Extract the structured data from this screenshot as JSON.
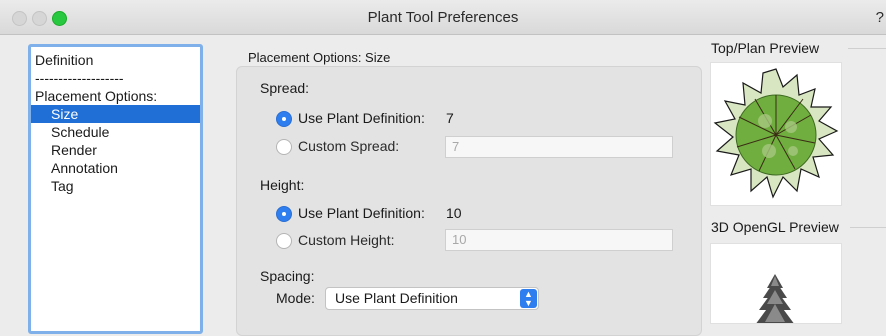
{
  "window": {
    "title": "Plant Tool Preferences",
    "help": "?"
  },
  "nav": {
    "items": [
      {
        "label": "Definition",
        "indent": false,
        "selected": false
      },
      {
        "label": "-------------------",
        "indent": false,
        "selected": false
      },
      {
        "label": "Placement Options:",
        "indent": false,
        "selected": false
      },
      {
        "label": "Size",
        "indent": true,
        "selected": true
      },
      {
        "label": "Schedule",
        "indent": true,
        "selected": false
      },
      {
        "label": "Render",
        "indent": true,
        "selected": false
      },
      {
        "label": "Annotation",
        "indent": true,
        "selected": false
      },
      {
        "label": "Tag",
        "indent": true,
        "selected": false
      }
    ]
  },
  "panel": {
    "section_title": "Placement Options: Size",
    "spread": {
      "heading": "Spread:",
      "use_definition_label": "Use Plant Definition:",
      "use_definition_value": "7",
      "custom_label": "Custom Spread:",
      "custom_value": "7",
      "selected": "use_definition"
    },
    "height": {
      "heading": "Height:",
      "use_definition_label": "Use Plant Definition:",
      "use_definition_value": "10",
      "custom_label": "Custom Height:",
      "custom_value": "10",
      "selected": "use_definition"
    },
    "spacing": {
      "heading": "Spacing:",
      "mode_label": "Mode:",
      "mode_value": "Use Plant Definition"
    }
  },
  "previews": {
    "top_plan_title": "Top/Plan Preview",
    "opengl_title": "3D OpenGL Preview"
  },
  "colors": {
    "accent": "#1f6fd6",
    "focus_ring": "#7fb0ea",
    "plant_green": "#6fae3f",
    "plant_light": "#d8e6c1"
  }
}
